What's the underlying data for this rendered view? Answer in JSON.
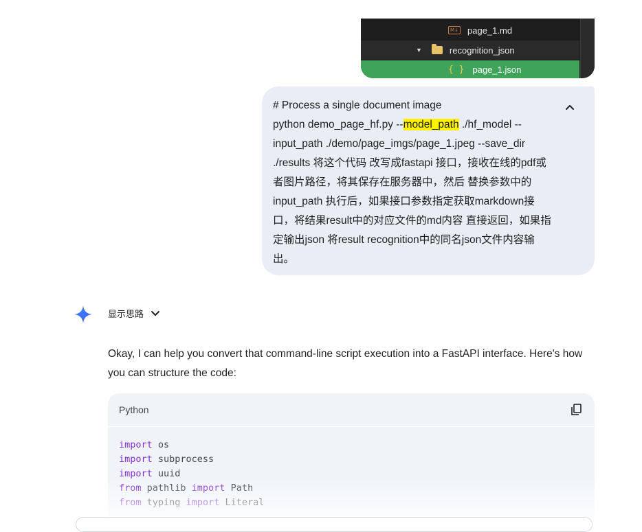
{
  "file_tree": {
    "items": [
      {
        "label": "page_1.md",
        "icon": "markdown-file-icon",
        "icon_text": "M↓"
      },
      {
        "label": "recognition_json",
        "icon": "folder-icon",
        "expanded": true
      },
      {
        "label": "page_1.json",
        "icon": "json-file-icon",
        "icon_text": "{ }",
        "selected": true
      }
    ],
    "selected_color": "#3fa35a"
  },
  "user_message": {
    "line1": "# Process a single document image",
    "cmd_prefix": "python demo_page_hf.py --",
    "highlight": "model_path",
    "cmd_rest": " ./hf_model --input_path ./demo/page_imgs/page_1.jpeg --save_dir ./results 将这个代码 改写成fastapi 接口，接收在线的pdf或者图片路径，将其保存在服务器中，然后 替换参数中的input_path 执行后，如果接口参数指定获取markdown接口，将结果result中的对应文件的md内容 直接返回，如果指定输出json 将result recognition中的同名json文件内容输出。",
    "collapse_icon": "chevron-up-icon"
  },
  "response": {
    "thinking_label": "显示思路",
    "intro": "Okay, I can help you convert that command-line script execution into a FastAPI interface. Here's how you can structure the code:",
    "code_block": {
      "language": "Python",
      "lines": [
        {
          "kw": "import",
          "rest": " os"
        },
        {
          "kw": "import",
          "rest": " subprocess"
        },
        {
          "kw": "import",
          "rest": " uuid"
        },
        {
          "kw": "from",
          "rest": " pathlib ",
          "kw2": "import",
          "rest2": " Path"
        },
        {
          "kw": "from",
          "rest": " typing ",
          "kw2": "import",
          "rest2": " Literal"
        }
      ]
    }
  },
  "colors": {
    "user_bubble": "#e9eef6",
    "highlight": "#fff200",
    "keyword": "#8430ce",
    "code_bg": "#f0f4f9"
  }
}
